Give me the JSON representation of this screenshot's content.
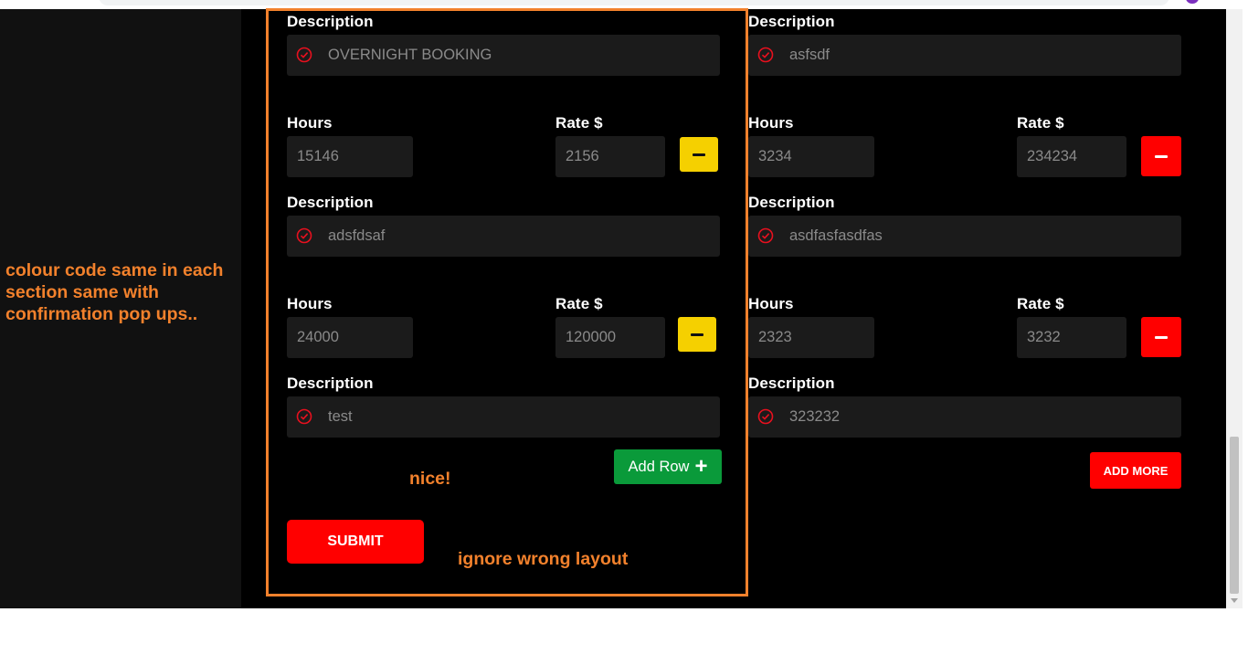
{
  "left_section": {
    "rows": [
      {
        "description_label": "Description",
        "description_value": "OVERNIGHT BOOKING",
        "hours_label": "Hours",
        "hours_value": "15146",
        "rate_label": "Rate $",
        "rate_value": "2156"
      },
      {
        "description_label": "Description",
        "description_value": "adsfdsaf",
        "hours_label": "Hours",
        "hours_value": "24000",
        "rate_label": "Rate $",
        "rate_value": "120000"
      },
      {
        "description_label": "Description",
        "description_value": "test"
      }
    ],
    "add_row_label": "Add Row",
    "add_row_icon": "plus-icon",
    "submit_label": "SUBMIT",
    "remove_button_color": "#f5d000"
  },
  "right_section": {
    "rows": [
      {
        "description_label": "Description",
        "description_value": "asfsdf",
        "hours_label": "Hours",
        "hours_value": "3234",
        "rate_label": "Rate $",
        "rate_value": "234234"
      },
      {
        "description_label": "Description",
        "description_value": "asdfasfasdfas",
        "hours_label": "Hours",
        "hours_value": "2323",
        "rate_label": "Rate $",
        "rate_value": "3232"
      },
      {
        "description_label": "Description",
        "description_value": "323232"
      }
    ],
    "add_more_label": "ADD MORE",
    "remove_button_color": "#ff0000"
  },
  "annotations": {
    "side_note": "colour code same in each section same with confirmation pop ups..",
    "nice": "nice!",
    "ignore": "ignore wrong layout",
    "highlight_color": "#f2812c"
  },
  "colors": {
    "background": "#000000",
    "field": "#1b1b1b",
    "accent_red": "#ff0000",
    "accent_green": "#0a9a3a",
    "accent_yellow": "#f5d000"
  }
}
